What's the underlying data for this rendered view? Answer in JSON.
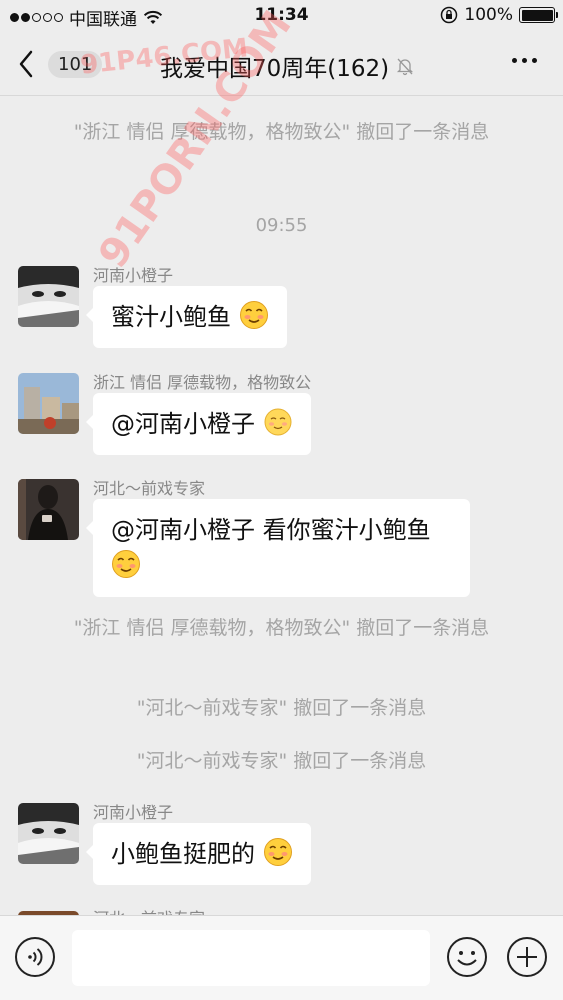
{
  "status_bar": {
    "carrier": "中国联通",
    "time": "11:34",
    "battery": "100%"
  },
  "nav": {
    "unread_count": "101",
    "title": "我爱中国70周年(162)"
  },
  "watermark": {
    "line1": "91P46.COM",
    "line2": "91PORN.COM"
  },
  "chat": {
    "recall_1": "\"浙江  情侣  厚德载物，格物致公\" 撤回了一条消息",
    "time_1": "09:55",
    "messages": [
      {
        "sender": "河南小橙子",
        "text": "蜜汁小鲍鱼",
        "emoji": "smiling-blush-emoji"
      },
      {
        "sender": "浙江  情侣  厚德载物，格物致公",
        "text": "@河南小橙子 ",
        "emoji": "smiling-blush-emoji"
      },
      {
        "sender": "河北～前戏专家",
        "text": "@河南小橙子 看你蜜汁小鲍鱼",
        "emoji": "smiling-blush-emoji"
      },
      {
        "sender": "河南小橙子",
        "text": "小鲍鱼挺肥的",
        "emoji": "smiling-blush-emoji"
      },
      {
        "sender": "河北～前戏专家"
      }
    ],
    "recall_2": "\"浙江  情侣  厚德载物，格物致公\" 撤回了一条消息",
    "recall_3": "\"河北～前戏专家\" 撤回了一条消息",
    "recall_4": "\"河北～前戏专家\" 撤回了一条消息"
  },
  "input_bar": {
    "text_value": "",
    "icons": [
      "voice-icon",
      "emoji-icon",
      "plus-icon"
    ]
  },
  "colors": {
    "background": "#ededed",
    "bubble": "#ffffff",
    "system_text": "#a5a5a5",
    "watermark": "#ff5a5a"
  }
}
